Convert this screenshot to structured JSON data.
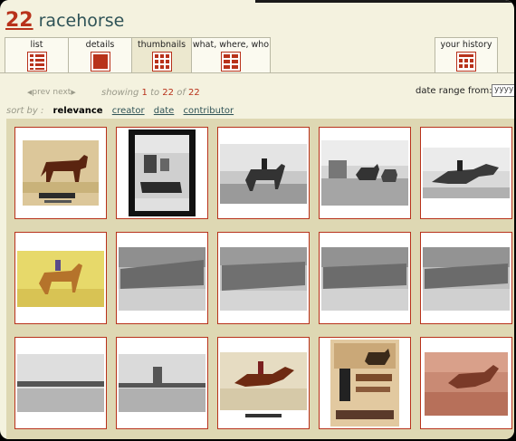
{
  "search": {
    "count": "22",
    "query": "racehorse"
  },
  "tabs": [
    {
      "label": "list",
      "icon": "list-icon"
    },
    {
      "label": "details",
      "icon": "details-icon"
    },
    {
      "label": "thumbnails",
      "icon": "thumbnails-icon"
    },
    {
      "label": "what, where, who",
      "icon": "grid-icon"
    },
    {
      "label": "your history",
      "icon": "history-icon"
    }
  ],
  "pager": {
    "prev": "prev",
    "next": "next",
    "showing_prefix": "showing",
    "start": "1",
    "to": "to",
    "end": "22",
    "of": "of",
    "total": "22"
  },
  "date_range": {
    "label": "date range from:",
    "value": "yyyy"
  },
  "sort": {
    "label": "sort by :",
    "options": [
      "relevance",
      "creator",
      "date",
      "contributor"
    ],
    "selected": "relevance"
  },
  "thumbnails": [
    {
      "subject": "painted bay horse standing"
    },
    {
      "subject": "glass negative of stable scene"
    },
    {
      "subject": "jockey on horse photograph"
    },
    {
      "subject": "horses at racetrack photograph"
    },
    {
      "subject": "racing horse engraving"
    },
    {
      "subject": "jockey on chestnut horse painting"
    },
    {
      "subject": "stable building photograph"
    },
    {
      "subject": "stable building photograph"
    },
    {
      "subject": "stable building photograph"
    },
    {
      "subject": "stable building photograph"
    },
    {
      "subject": "racetrack grandstand photograph"
    },
    {
      "subject": "racetrack grandstand photograph"
    },
    {
      "subject": "racing horse lithograph"
    },
    {
      "subject": "sheet music cover"
    },
    {
      "subject": "horse jumping print"
    }
  ],
  "colors": {
    "accent": "#b8321b",
    "link": "#2f5357",
    "background": "#f4f2df",
    "grid": "#ded8b3"
  }
}
